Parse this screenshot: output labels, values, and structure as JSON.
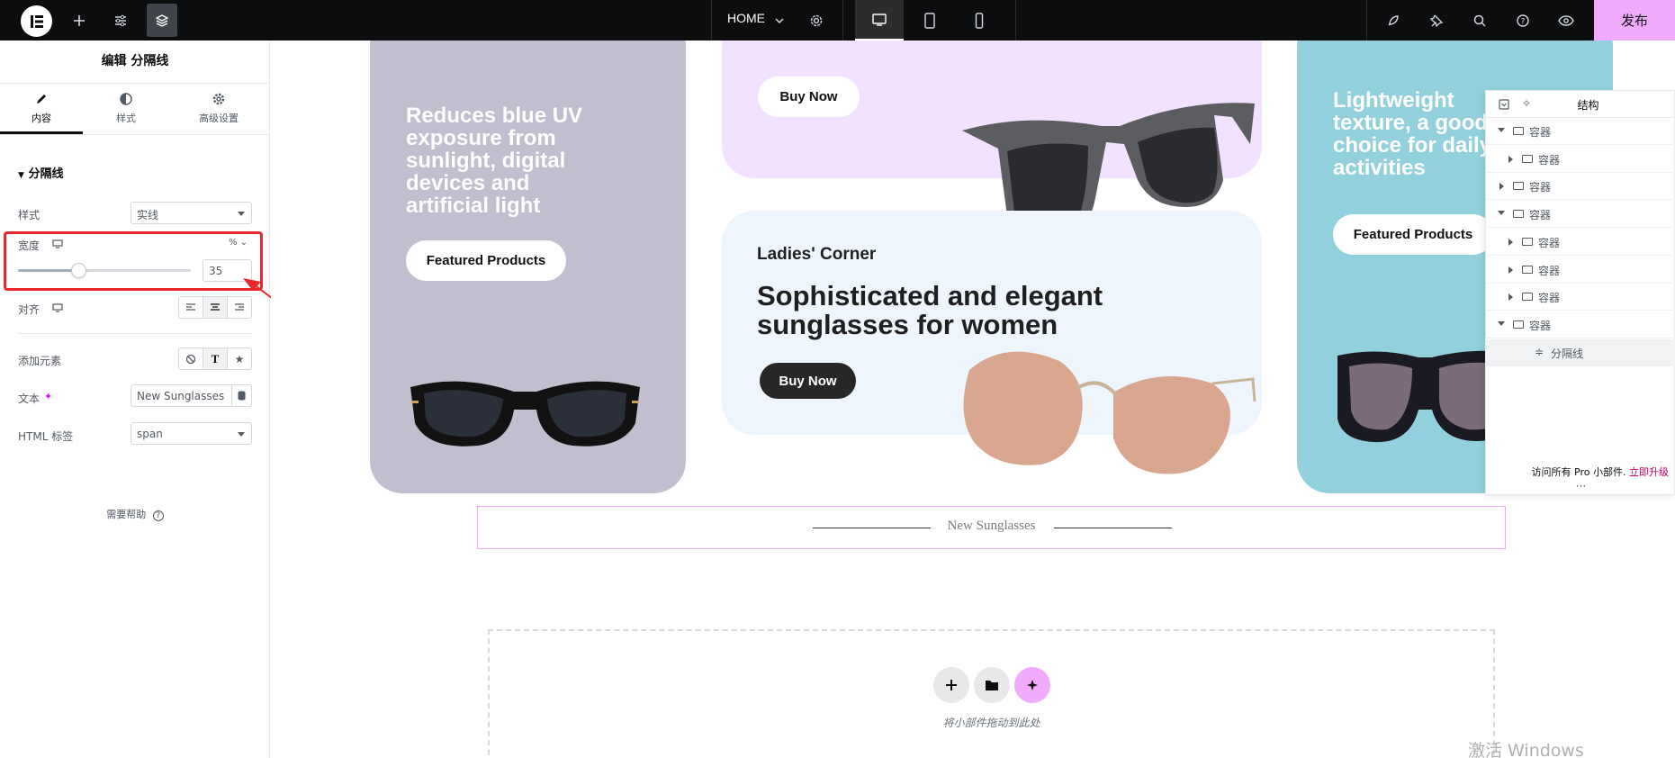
{
  "topbar": {
    "page_name": "HOME",
    "publish_label": "发布"
  },
  "panel": {
    "title": "编辑 分隔线",
    "tabs": [
      "内容",
      "样式",
      "高级设置"
    ],
    "section": "分隔线",
    "style_label": "样式",
    "style_value": "实线",
    "width_label": "宽度",
    "width_unit": "%",
    "width_value": "35",
    "width_slider_fraction": 0.35,
    "align_label": "对齐",
    "add_element_label": "添加元素",
    "text_label": "文本",
    "text_value": "New Sunglasses",
    "html_tag_label": "HTML 标签",
    "html_tag_value": "span",
    "help_label": "需要帮助"
  },
  "canvas": {
    "card1_headline": "Reduces blue UV exposure from sunlight, digital devices and artificial light",
    "card1_button": "Featured Products",
    "card2_button": "Buy Now",
    "card3_small": "Ladies' Corner",
    "card3_big": "Sophisticated and elegant sunglasses for women",
    "card3_button": "Buy Now",
    "card4_headline": "Lightweight texture, a good choice for daily activities",
    "card4_button": "Featured Products",
    "divider_text": "New Sunglasses",
    "dropzone_text": "将小部件拖动到此处"
  },
  "navigator": {
    "title": "结构",
    "rows": [
      {
        "label": "容器",
        "level": 0,
        "state": "open"
      },
      {
        "label": "容器",
        "level": 1,
        "state": "closed"
      },
      {
        "label": "容器",
        "level": 0,
        "state": "closed"
      },
      {
        "label": "容器",
        "level": 0,
        "state": "open"
      },
      {
        "label": "容器",
        "level": 1,
        "state": "closed"
      },
      {
        "label": "容器",
        "level": 1,
        "state": "closed"
      },
      {
        "label": "容器",
        "level": 1,
        "state": "closed"
      },
      {
        "label": "容器",
        "level": 0,
        "state": "open"
      },
      {
        "label": "分隔线",
        "level": 1,
        "state": "leaf"
      }
    ],
    "footer_text": "访问所有 Pro 小部件.",
    "footer_link": "立即升级"
  },
  "watermark": "激活 Windows",
  "colors": {
    "topbar_bg": "#0c0d0e",
    "publish_bg": "#f0abfc",
    "highlight_red": "#e8272d",
    "card_purple": "#c2bed0",
    "card_pink": "#f2e1ff",
    "card_blue": "#eef5fd",
    "card_teal": "#93d0de"
  }
}
